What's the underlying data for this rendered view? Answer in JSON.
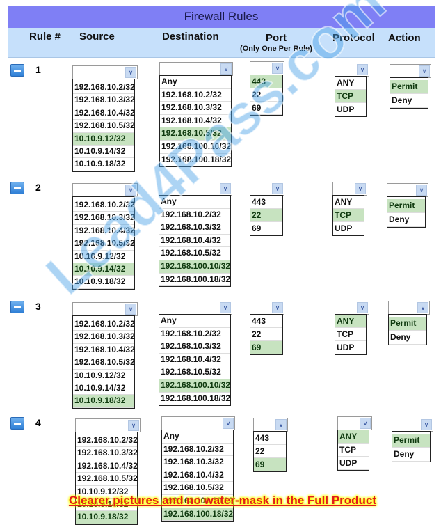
{
  "title": "Firewall Rules",
  "headers": {
    "rule": "Rule #",
    "source": "Source",
    "destination": "Destination",
    "port": "Port",
    "port_note": "(Only One Per Rule)",
    "protocol": "Protocol",
    "action": "Action"
  },
  "options": {
    "source": [
      "192.168.10.2/32",
      "192.168.10.3/32",
      "192.168.10.4/32",
      "192.168.10.5/32",
      "10.10.9.12/32",
      "10.10.9.14/32",
      "10.10.9.18/32"
    ],
    "destination": [
      "Any",
      "192.168.10.2/32",
      "192.168.10.3/32",
      "192.168.10.4/32",
      "192.168.10.5/32",
      "192.168.100.10/32",
      "192.168.100.18/32"
    ],
    "port": [
      "443",
      "22",
      "69"
    ],
    "protocol": [
      "ANY",
      "TCP",
      "UDP"
    ],
    "action": [
      "Permit",
      "Deny"
    ]
  },
  "rules": [
    {
      "number": "1",
      "source": "10.10.9.12/32",
      "destination": "192.168.10.5/32",
      "port": "443",
      "protocol": "TCP",
      "action": "Permit"
    },
    {
      "number": "2",
      "source": "10.10.9.14/32",
      "destination": "192.168.100.10/32",
      "port": "22",
      "protocol": "TCP",
      "action": "Permit"
    },
    {
      "number": "3",
      "source": "10.10.9.18/32",
      "destination": "192.168.100.10/32",
      "port": "69",
      "protocol": "ANY",
      "action": "Permit"
    },
    {
      "number": "4",
      "source": "10.10.9.18/32",
      "destination": "192.168.100.18/32",
      "port": "69",
      "protocol": "ANY",
      "action": "Permit"
    }
  ],
  "colors": {
    "title_bg": "#7f7ff5",
    "header_bg": "#c6e0fb",
    "selected_bg": "#c7e3c0"
  },
  "watermark": "Lead4Pass.com",
  "banner": "Clearer pictures and no water-mask in the Full Product"
}
